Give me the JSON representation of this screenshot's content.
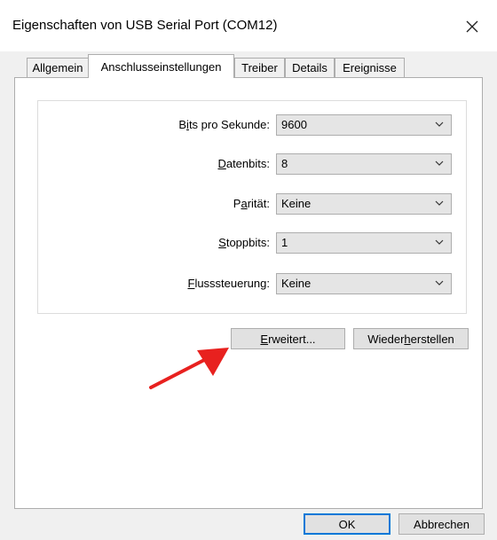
{
  "window": {
    "title": "Eigenschaften von USB Serial Port (COM12)",
    "close_icon": "close-icon"
  },
  "tabs": [
    {
      "label": "Allgemein",
      "active": false
    },
    {
      "label": "Anschlusseinstellungen",
      "active": true
    },
    {
      "label": "Treiber",
      "active": false
    },
    {
      "label": "Details",
      "active": false
    },
    {
      "label": "Ereignisse",
      "active": false
    }
  ],
  "settings": {
    "bits_per_second": {
      "label_pre": "B",
      "label_u": "i",
      "label_post": "ts pro Sekunde:",
      "value": "9600"
    },
    "data_bits": {
      "label_pre": "",
      "label_u": "D",
      "label_post": "atenbits:",
      "value": "8"
    },
    "parity": {
      "label_pre": "P",
      "label_u": "a",
      "label_post": "rität:",
      "value": "Keine"
    },
    "stop_bits": {
      "label_pre": "",
      "label_u": "S",
      "label_post": "toppbits:",
      "value": "1"
    },
    "flow_control": {
      "label_pre": "",
      "label_u": "F",
      "label_post": "lusssteuerung:",
      "value": "Keine"
    }
  },
  "buttons": {
    "advanced": {
      "pre": "",
      "u": "E",
      "post": "rweitert..."
    },
    "restore": {
      "pre": "Wieder",
      "u": "h",
      "post": "erstellen"
    },
    "ok": "OK",
    "cancel": "Abbrechen"
  },
  "colors": {
    "annotation_arrow": "#e8211f",
    "focus_border": "#0078d7"
  }
}
